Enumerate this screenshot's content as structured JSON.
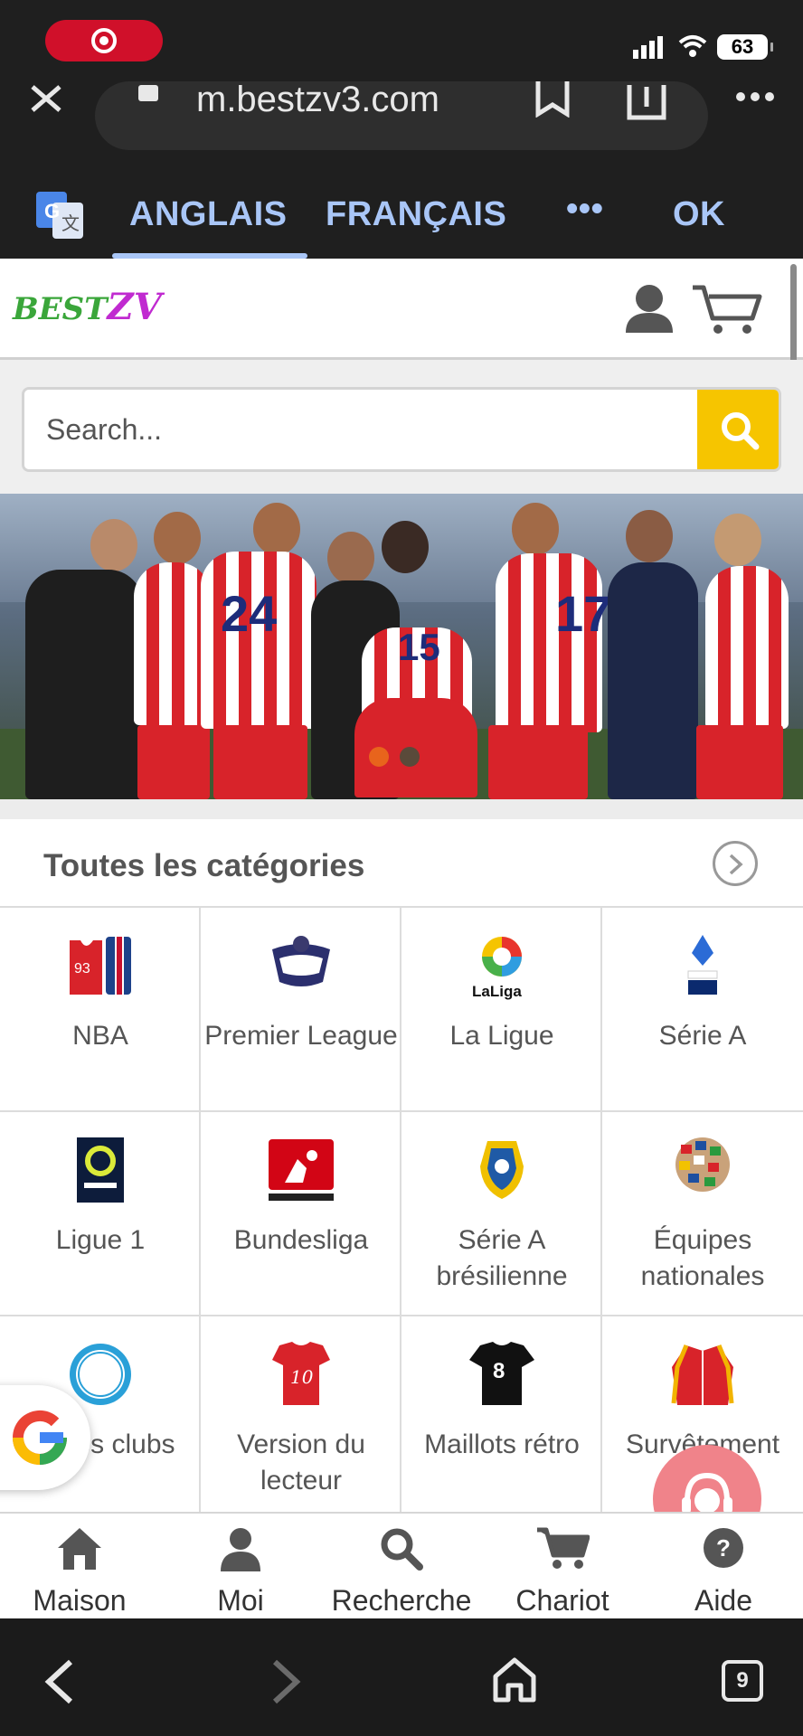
{
  "status_bar": {
    "battery": "63",
    "recording": true
  },
  "browser": {
    "url": "m.bestzv3.com",
    "icons": [
      "close-icon",
      "lock-icon",
      "bookmark-icon",
      "share-icon",
      "more-icon"
    ]
  },
  "translate_bar": {
    "languages": [
      "ANGLAIS",
      "FRANÇAIS"
    ],
    "more": "•••",
    "ok": "OK",
    "active_index": 0,
    "accent": "#a9c6f7"
  },
  "site": {
    "logo_part1": "BEST",
    "logo_part2": "ZV",
    "search_placeholder": "Search...",
    "search_button_color": "#f6c500"
  },
  "banner": {
    "jersey_numbers": [
      "24",
      "15",
      "17"
    ],
    "slides": 2,
    "active_slide": 0
  },
  "categories": {
    "title": "Toutes les catégories",
    "items": [
      {
        "label": "NBA",
        "icon": "nba-jersey-icon"
      },
      {
        "label": "Premier League",
        "icon": "premier-league-icon"
      },
      {
        "label": "La Ligue",
        "icon": "laliga-icon"
      },
      {
        "label": "Série A",
        "icon": "serie-a-icon"
      },
      {
        "label": "Ligue 1",
        "icon": "ligue1-icon"
      },
      {
        "label": "Bundesliga",
        "icon": "bundesliga-icon"
      },
      {
        "label": "Série A brésilienne",
        "icon": "brasileirao-icon"
      },
      {
        "label": "Équipes nationales",
        "icon": "national-teams-icon"
      },
      {
        "label": "Autres clubs",
        "icon": "other-clubs-icon"
      },
      {
        "label": "Version du lecteur",
        "icon": "player-version-icon"
      },
      {
        "label": "Maillots rétro",
        "icon": "retro-jersey-icon"
      },
      {
        "label": "Survêtement",
        "icon": "tracksuit-icon"
      }
    ]
  },
  "bottom_nav": {
    "items": [
      {
        "label": "Maison",
        "icon": "home-icon"
      },
      {
        "label": "Moi",
        "icon": "user-icon"
      },
      {
        "label": "Recherche",
        "icon": "search-icon"
      },
      {
        "label": "Chariot",
        "icon": "cart-icon"
      },
      {
        "label": "Aide",
        "icon": "help-icon"
      }
    ]
  },
  "system_nav": {
    "tabs_count": "9"
  }
}
